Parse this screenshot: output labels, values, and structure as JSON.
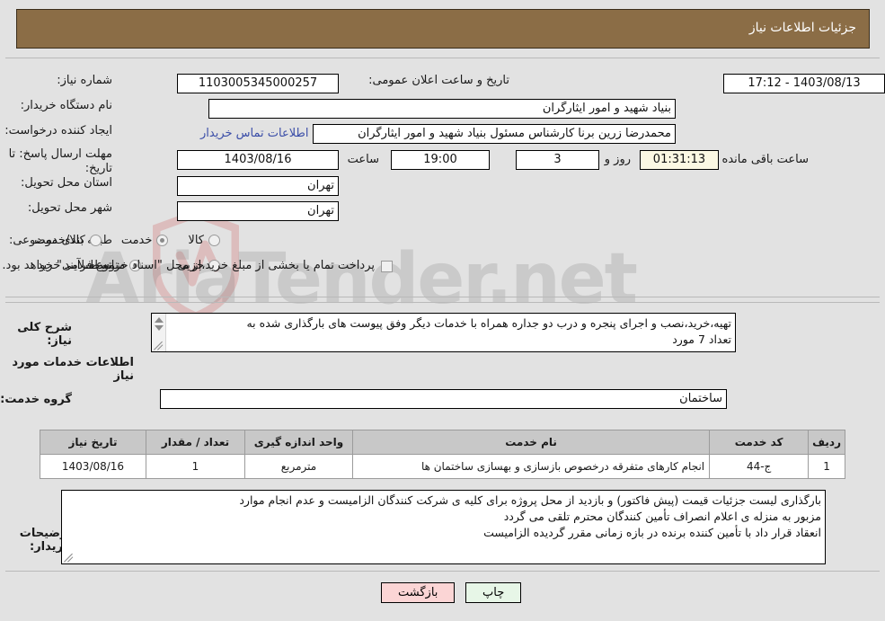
{
  "header": {
    "title": "جزئیات اطلاعات نیاز"
  },
  "watermark": {
    "text": "AriaTender.net",
    "shield_icon": "shield-icon"
  },
  "form": {
    "need_number": {
      "label": "شماره نیاز:",
      "value": "1103005345000257"
    },
    "announce_datetime": {
      "label": "تاریخ و ساعت اعلان عمومی:",
      "value": "1403/08/13 - 17:12"
    },
    "buyer_org": {
      "label": "نام دستگاه خریدار:",
      "value": "بنیاد شهید و امور ایثارگران"
    },
    "requester": {
      "label": "ایجاد کننده درخواست:",
      "value": "محمدرضا زرین برنا کارشناس مسئول  بنیاد شهید و امور ایثارگران"
    },
    "contact_link": {
      "label": "اطلاعات تماس خریدار"
    },
    "deadline": {
      "label_line1": "مهلت ارسال پاسخ: تا",
      "label_line2": "تاریخ:",
      "date_value": "1403/08/16",
      "hour_label": "ساعت",
      "hour_value": "19:00",
      "days_value": "3",
      "days_label": "روز و",
      "remaining_value": "01:31:13",
      "remaining_label": "ساعت باقی مانده"
    },
    "province": {
      "label": "استان محل تحویل:",
      "value": "تهران"
    },
    "city": {
      "label": "شهر محل تحویل:",
      "value": "تهران"
    },
    "category": {
      "label": "طبقه بندی موضوعی:",
      "options": [
        {
          "label": "کالا",
          "selected": false
        },
        {
          "label": "خدمت",
          "selected": true
        },
        {
          "label": "کالا/خدمت",
          "selected": false
        }
      ]
    },
    "process_type": {
      "label": "نوع فرآیند خرید :",
      "options": [
        {
          "label": "جزیی",
          "selected": false
        },
        {
          "label": "متوسط",
          "selected": true
        }
      ],
      "checkbox": {
        "label": "پرداخت تمام یا بخشی از مبلغ خرید،از محل \"اسناد خزانه اسلامی\" خواهد بود.",
        "checked": false
      }
    },
    "general_description": {
      "label": "شرح کلی نیاز:",
      "line1": "تهیه،خرید،نصب و اجرای پنجره و درب دو جداره همراه با خدمات دیگر وفق پیوست های بارگذاری شده به",
      "line2": "تعداد 7 مورد"
    },
    "services_heading": "اطلاعات خدمات مورد نیاز",
    "service_group": {
      "label": "گروه خدمت:",
      "value": "ساختمان"
    },
    "buyer_notes": {
      "label": "توضیحات خریدار:",
      "line1": "بارگذاری لیست جزئیات قیمت (پیش فاکتور) و بازدید از محل پروژه برای کلیه ی شرکت کنندگان الزامیست و عدم انجام موارد",
      "line2": "مزبور به منزله ی اعلام انصراف تأمین کنندگان محترم تلقی می گردد",
      "line3": "انعقاد قرار داد با تأمین کننده برنده در بازه زمانی مقرر گردیده الزامیست"
    }
  },
  "table": {
    "columns": [
      "ردیف",
      "کد خدمت",
      "نام خدمت",
      "واحد اندازه گیری",
      "تعداد / مقدار",
      "تاریخ نیاز"
    ],
    "rows": [
      {
        "radif": "1",
        "code": "ج-44",
        "name": "انجام کارهای متفرقه درخصوص بازسازی و بهسازی ساختمان ها",
        "unit": "مترمربع",
        "qty": "1",
        "date": "1403/08/16"
      }
    ]
  },
  "buttons": {
    "print": "چاپ",
    "back": "بازگشت"
  },
  "colors": {
    "header_bar": "#8b6d46",
    "page_bg": "#e2e2e2",
    "link": "#3b4ea8",
    "print_btn": "#e7f6e7",
    "back_btn": "#fbd5d5",
    "cream_field": "#fbf8e3",
    "table_header": "#c8c8c8"
  }
}
